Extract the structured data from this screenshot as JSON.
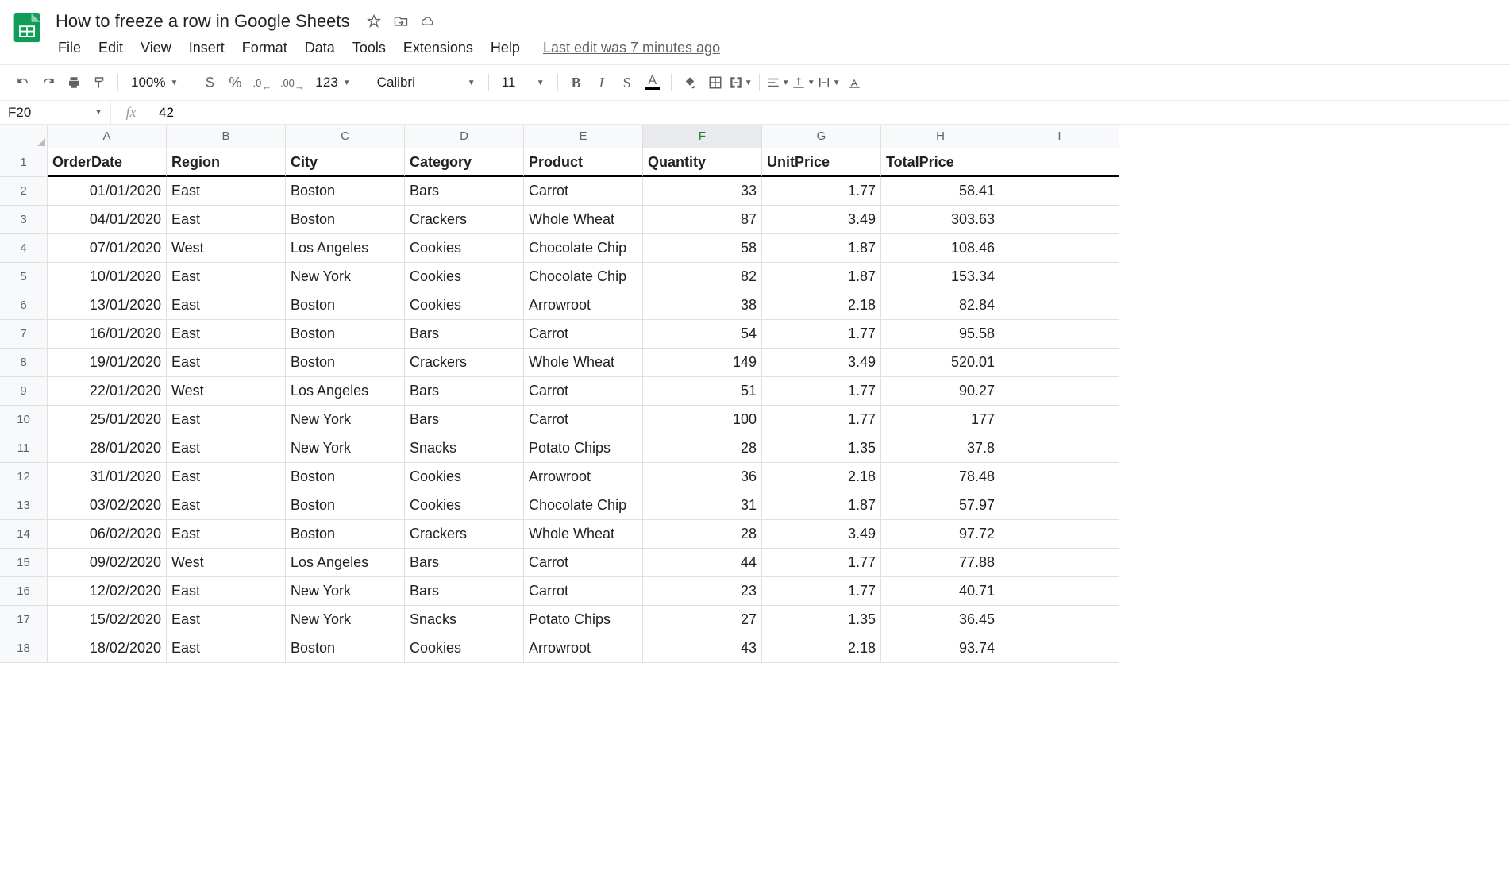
{
  "doc_title": "How to freeze a row in Google Sheets",
  "menu": [
    "File",
    "Edit",
    "View",
    "Insert",
    "Format",
    "Data",
    "Tools",
    "Extensions",
    "Help"
  ],
  "last_edit": "Last edit was 7 minutes ago",
  "toolbar": {
    "zoom": "100%",
    "currency": "$",
    "percent": "%",
    "dec_minus": ".0",
    "dec_plus": ".00",
    "more_formats": "123",
    "font": "Calibri",
    "font_size": "11"
  },
  "name_box": "F20",
  "fx_value": "42",
  "columns": [
    "A",
    "B",
    "C",
    "D",
    "E",
    "F",
    "G",
    "H",
    "I"
  ],
  "active_col": "F",
  "row_count": 18,
  "headers": [
    "OrderDate",
    "Region",
    "City",
    "Category",
    "Product",
    "Quantity",
    "UnitPrice",
    "TotalPrice"
  ],
  "rows": [
    [
      "01/01/2020",
      "East",
      "Boston",
      "Bars",
      "Carrot",
      "33",
      "1.77",
      "58.41"
    ],
    [
      "04/01/2020",
      "East",
      "Boston",
      "Crackers",
      "Whole Wheat",
      "87",
      "3.49",
      "303.63"
    ],
    [
      "07/01/2020",
      "West",
      "Los Angeles",
      "Cookies",
      "Chocolate Chip",
      "58",
      "1.87",
      "108.46"
    ],
    [
      "10/01/2020",
      "East",
      "New York",
      "Cookies",
      "Chocolate Chip",
      "82",
      "1.87",
      "153.34"
    ],
    [
      "13/01/2020",
      "East",
      "Boston",
      "Cookies",
      "Arrowroot",
      "38",
      "2.18",
      "82.84"
    ],
    [
      "16/01/2020",
      "East",
      "Boston",
      "Bars",
      "Carrot",
      "54",
      "1.77",
      "95.58"
    ],
    [
      "19/01/2020",
      "East",
      "Boston",
      "Crackers",
      "Whole Wheat",
      "149",
      "3.49",
      "520.01"
    ],
    [
      "22/01/2020",
      "West",
      "Los Angeles",
      "Bars",
      "Carrot",
      "51",
      "1.77",
      "90.27"
    ],
    [
      "25/01/2020",
      "East",
      "New York",
      "Bars",
      "Carrot",
      "100",
      "1.77",
      "177"
    ],
    [
      "28/01/2020",
      "East",
      "New York",
      "Snacks",
      "Potato Chips",
      "28",
      "1.35",
      "37.8"
    ],
    [
      "31/01/2020",
      "East",
      "Boston",
      "Cookies",
      "Arrowroot",
      "36",
      "2.18",
      "78.48"
    ],
    [
      "03/02/2020",
      "East",
      "Boston",
      "Cookies",
      "Chocolate Chip",
      "31",
      "1.87",
      "57.97"
    ],
    [
      "06/02/2020",
      "East",
      "Boston",
      "Crackers",
      "Whole Wheat",
      "28",
      "3.49",
      "97.72"
    ],
    [
      "09/02/2020",
      "West",
      "Los Angeles",
      "Bars",
      "Carrot",
      "44",
      "1.77",
      "77.88"
    ],
    [
      "12/02/2020",
      "East",
      "New York",
      "Bars",
      "Carrot",
      "23",
      "1.77",
      "40.71"
    ],
    [
      "15/02/2020",
      "East",
      "New York",
      "Snacks",
      "Potato Chips",
      "27",
      "1.35",
      "36.45"
    ],
    [
      "18/02/2020",
      "East",
      "Boston",
      "Cookies",
      "Arrowroot",
      "43",
      "2.18",
      "93.74"
    ]
  ]
}
